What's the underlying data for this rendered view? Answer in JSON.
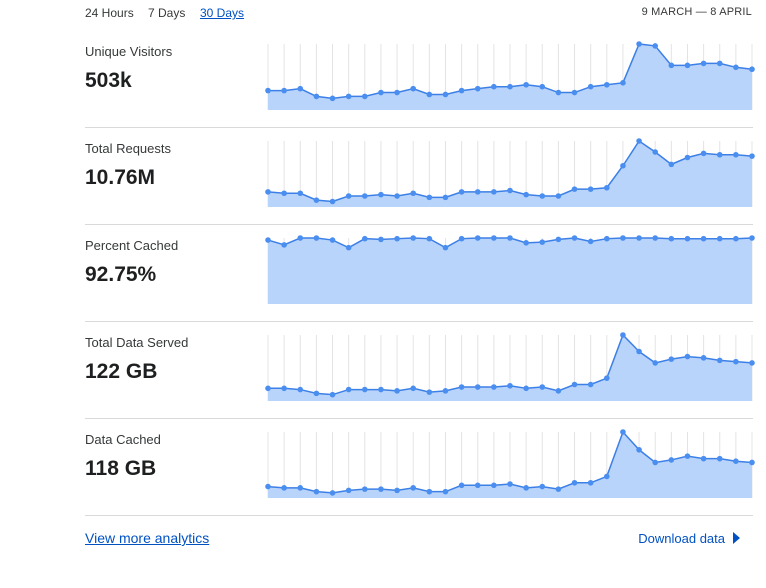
{
  "time_tabs": [
    {
      "label": "24 Hours",
      "active": false
    },
    {
      "label": "7 Days",
      "active": false
    },
    {
      "label": "30 Days",
      "active": true
    }
  ],
  "date_range": "9 MARCH — 8 APRIL",
  "colors": {
    "accent": "#0051c3",
    "line": "#3c7fe6",
    "fill": "#b9d4fb",
    "dot": "#4a8ef0"
  },
  "metrics": [
    {
      "label": "Unique Visitors",
      "value": "503k",
      "series": [
        10,
        10,
        11,
        7,
        6,
        7,
        7,
        9,
        9,
        11,
        8,
        8,
        10,
        11,
        12,
        12,
        13,
        12,
        9,
        9,
        12,
        13,
        14,
        34,
        33,
        23,
        23,
        24,
        24,
        22,
        21
      ]
    },
    {
      "label": "Total Requests",
      "value": "10.76M",
      "series": [
        11,
        10,
        10,
        5,
        4,
        8,
        8,
        9,
        8,
        10,
        7,
        7,
        11,
        11,
        11,
        12,
        9,
        8,
        8,
        13,
        13,
        14,
        30,
        48,
        40,
        31,
        36,
        39,
        38,
        38,
        37
      ]
    },
    {
      "label": "Percent Cached",
      "value": "92.75%",
      "series": [
        93,
        86,
        96,
        96,
        93,
        82,
        95,
        94,
        95,
        96,
        95,
        82,
        95,
        96,
        96,
        96,
        89,
        90,
        94,
        96,
        91,
        95,
        96,
        96,
        96,
        95,
        95,
        95,
        95,
        95,
        96
      ]
    },
    {
      "label": "Total Data Served",
      "value": "122 GB",
      "series": [
        10,
        10,
        9,
        6,
        5,
        9,
        9,
        9,
        8,
        10,
        7,
        8,
        11,
        11,
        11,
        12,
        10,
        11,
        8,
        13,
        13,
        18,
        52,
        39,
        30,
        33,
        35,
        34,
        32,
        31,
        30
      ]
    },
    {
      "label": "Data Cached",
      "value": "118 GB",
      "series": [
        9,
        8,
        8,
        5,
        4,
        6,
        7,
        7,
        6,
        8,
        5,
        5,
        10,
        10,
        10,
        11,
        8,
        9,
        7,
        12,
        12,
        17,
        52,
        38,
        28,
        30,
        33,
        31,
        31,
        29,
        28
      ]
    }
  ],
  "footer": {
    "view_more": "View more analytics",
    "download": "Download data"
  }
}
